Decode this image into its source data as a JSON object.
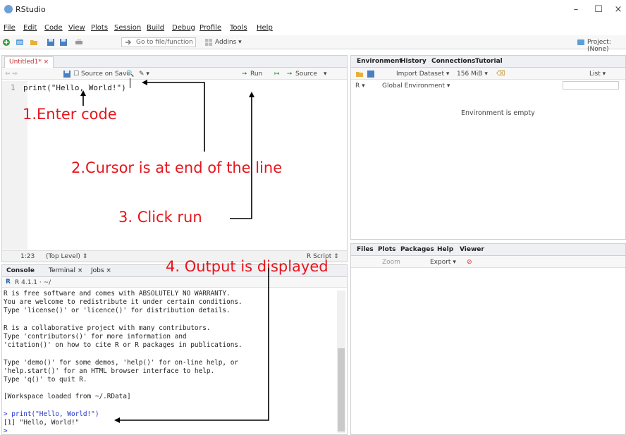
{
  "window": {
    "title": "RStudio",
    "minimize": "–",
    "maximize": "☐",
    "close": "×"
  },
  "menu": [
    "File",
    "Edit",
    "Code",
    "View",
    "Plots",
    "Session",
    "Build",
    "Debug",
    "Profile",
    "Tools",
    "Help"
  ],
  "toolbar": {
    "goto_placeholder": "Go to file/function",
    "addins": "Addins ▾",
    "project": "Project: (None)"
  },
  "source": {
    "tab_label": "Untitled1* ×",
    "source_on_save": "Source on Save",
    "run_label": "Run",
    "source_label": "Source",
    "line_number": "1",
    "code": "print(\"Hello, World!\")",
    "cursor_pos": "1:23",
    "scope": "(Top Level) ⇕",
    "file_type": "R Script ⇕"
  },
  "console": {
    "tabs": [
      "Console",
      "Terminal ×",
      "Jobs ×"
    ],
    "path": "R 4.1.1 · ~/",
    "lines": [
      "R is free software and comes with ABSOLUTELY NO WARRANTY.",
      "You are welcome to redistribute it under certain conditions.",
      "Type 'license()' or 'licence()' for distribution details.",
      "",
      "R is a collaborative project with many contributors.",
      "Type 'contributors()' for more information and",
      "'citation()' on how to cite R or R packages in publications.",
      "",
      "Type 'demo()' for some demos, 'help()' for on-line help, or",
      "'help.start()' for an HTML browser interface to help.",
      "Type 'q()' to quit R.",
      "",
      "[Workspace loaded from ~/.RData]",
      ""
    ],
    "command": "> print(\"Hello, World!\")",
    "output": "[1] \"Hello, World!\"",
    "prompt": ">"
  },
  "environment": {
    "tabs": [
      "Environment",
      "History",
      "Connections",
      "Tutorial"
    ],
    "import_dataset": "Import Dataset ▾",
    "memory": "156 MiB ▾",
    "list_view": "List ▾",
    "r_selector": "R ▾",
    "scope": "Global Environment ▾",
    "empty_message": "Environment is empty"
  },
  "files": {
    "tabs": [
      "Files",
      "Plots",
      "Packages",
      "Help",
      "Viewer"
    ],
    "zoom": "Zoom",
    "export": "Export ▾"
  },
  "annotations": {
    "step1": "1.Enter code",
    "step2": "2.Cursor is at end of the line",
    "step3": "3. Click run",
    "step4": "4. Output is displayed"
  },
  "colors": {
    "annotation": "#e8141b",
    "console_command": "#1f32c8",
    "tab_unsaved": "#c03030"
  }
}
